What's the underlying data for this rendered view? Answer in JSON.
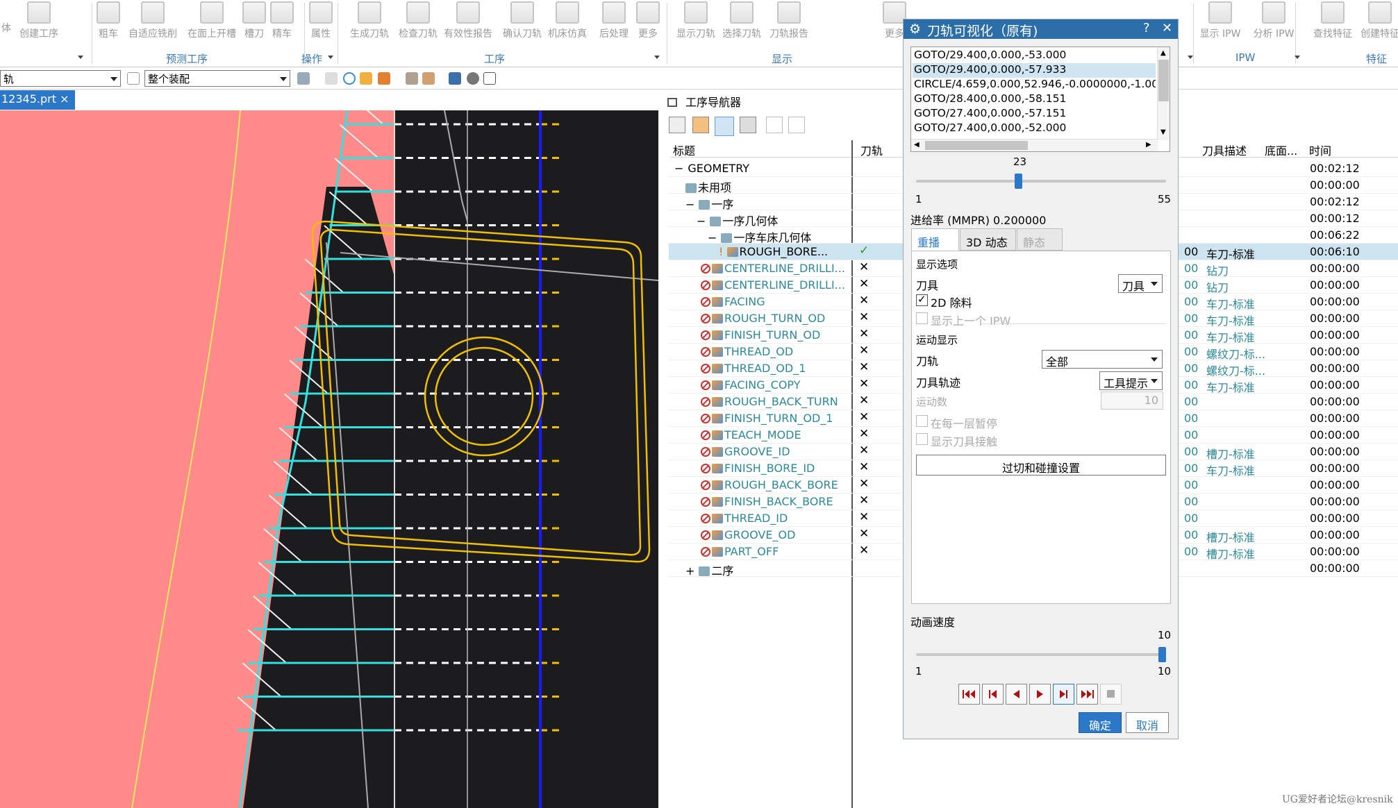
{
  "ribbon": {
    "buttons": [
      "体",
      "创建工序",
      "粗车",
      "自适应铣削",
      "在面上开槽",
      "槽刀",
      "精车",
      "属性",
      "生成刀轨",
      "检查刀轨",
      "有效性报告",
      "确认刀轨",
      "机床仿真",
      "后处理",
      "更多",
      "显示刀轨",
      "选择刀轨",
      "刀轨报告",
      "更多",
      "显示 IPW",
      "分析 IPW",
      "查找特征",
      "创建特征"
    ],
    "groups": [
      "预测工序",
      "操作",
      "工序",
      "显示",
      "IPW",
      "特征"
    ]
  },
  "toolbar2": {
    "filter_value": "轨",
    "assembly_value": "整个装配"
  },
  "file_tab": {
    "label": "12345.prt",
    "close": "×"
  },
  "navigator": {
    "title": "工序导航器",
    "columns": [
      "标题",
      "刀轨",
      "刀具描述",
      "底面...",
      "时间"
    ],
    "rows": [
      {
        "name": "GEOMETRY",
        "path": "",
        "tool": "",
        "time": "00:02:12"
      },
      {
        "name": "未用项",
        "path": "",
        "tool": "",
        "time": "00:00:00"
      },
      {
        "name": "一序",
        "path": "",
        "tool": "",
        "time": "00:02:12"
      },
      {
        "name": "一序几何体",
        "path": "",
        "tool": "",
        "time": "00:00:12"
      },
      {
        "name": "一序车床几何体",
        "path": "",
        "tool": "",
        "time": "00:06:22"
      },
      {
        "name": "ROUGH_BORE...",
        "path": "✓",
        "tool": "车刀-标准",
        "time": "00:06:10"
      },
      {
        "name": "CENTERLINE_DRILLI...",
        "path": "✕",
        "tool": "钻刀",
        "time": "00:00:00"
      },
      {
        "name": "CENTERLINE_DRILLI...",
        "path": "✕",
        "tool": "钻刀",
        "time": "00:00:00"
      },
      {
        "name": "FACING",
        "path": "✕",
        "tool": "车刀-标准",
        "time": "00:00:00"
      },
      {
        "name": "ROUGH_TURN_OD",
        "path": "✕",
        "tool": "车刀-标准",
        "time": "00:00:00"
      },
      {
        "name": "FINISH_TURN_OD",
        "path": "✕",
        "tool": "车刀-标准",
        "time": "00:00:00"
      },
      {
        "name": "THREAD_OD",
        "path": "✕",
        "tool": "螺纹刀-标...",
        "time": "00:00:00"
      },
      {
        "name": "THREAD_OD_1",
        "path": "✕",
        "tool": "螺纹刀-标...",
        "time": "00:00:00"
      },
      {
        "name": "FACING_COPY",
        "path": "✕",
        "tool": "车刀-标准",
        "time": "00:00:00"
      },
      {
        "name": "ROUGH_BACK_TURN",
        "path": "✕",
        "tool": "",
        "time": "00:00:00"
      },
      {
        "name": "FINISH_TURN_OD_1",
        "path": "✕",
        "tool": "",
        "time": "00:00:00"
      },
      {
        "name": "TEACH_MODE",
        "path": "✕",
        "tool": "",
        "time": "00:00:00"
      },
      {
        "name": "GROOVE_ID",
        "path": "✕",
        "tool": "槽刀-标准",
        "time": "00:00:00"
      },
      {
        "name": "FINISH_BORE_ID",
        "path": "✕",
        "tool": "车刀-标准",
        "time": "00:00:00"
      },
      {
        "name": "ROUGH_BACK_BORE",
        "path": "✕",
        "tool": "",
        "time": "00:00:00"
      },
      {
        "name": "FINISH_BACK_BORE",
        "path": "✕",
        "tool": "",
        "time": "00:00:00"
      },
      {
        "name": "THREAD_ID",
        "path": "✕",
        "tool": "",
        "time": "00:00:00"
      },
      {
        "name": "GROOVE_OD",
        "path": "✕",
        "tool": "槽刀-标准",
        "time": "00:00:00"
      },
      {
        "name": "PART_OFF",
        "path": "✕",
        "tool": "槽刀-标准",
        "time": "00:00:00"
      },
      {
        "name": "二序",
        "path": "",
        "tool": "",
        "time": "00:00:00"
      }
    ],
    "z_prefix": "00",
    "minus": "−",
    "plus": "+"
  },
  "dialog": {
    "title": "刀轨可视化（原有)",
    "help": "?",
    "close": "✕",
    "list": [
      "GOTO/29.400,0.000,-53.000",
      "GOTO/29.400,0.000,-57.933",
      "CIRCLE/4.659,0.000,52.946,-0.0000000,-1.00000",
      "GOTO/28.400,0.000,-58.151",
      "GOTO/27.400,0.000,-57.151",
      "GOTO/27.400,0.000,-52.000"
    ],
    "selected_index": 1,
    "slider": {
      "value": "23",
      "min": "1",
      "max": "55",
      "fraction": 0.407
    },
    "feed_rate": "进给率 (MMPR) 0.200000",
    "tabs": [
      "重播",
      "3D 动态",
      "静态"
    ],
    "display_options": "显示选项",
    "tool_label": "刀具",
    "tool_value": "刀具",
    "remove_2d": "2D 除料",
    "show_prev_ipw": "显示上一个 IPW",
    "motion_display": "运动显示",
    "path_label": "刀轨",
    "path_value": "全部",
    "trace_label": "刀具轨迹",
    "trace_value": "工具提示",
    "motion_count_label": "运动数",
    "motion_count_value": "10",
    "pause_each_layer": "在每一层暂停",
    "show_tool_contact": "显示刀具接触",
    "gouge_button": "过切和碰撞设置",
    "anim_speed": "动画速度",
    "speed": {
      "value": "10",
      "min": "1",
      "max": "10",
      "fraction": 1.0
    },
    "ok": "确定",
    "cancel": "取消"
  },
  "watermark": "UG爱好者论坛@kresnik"
}
